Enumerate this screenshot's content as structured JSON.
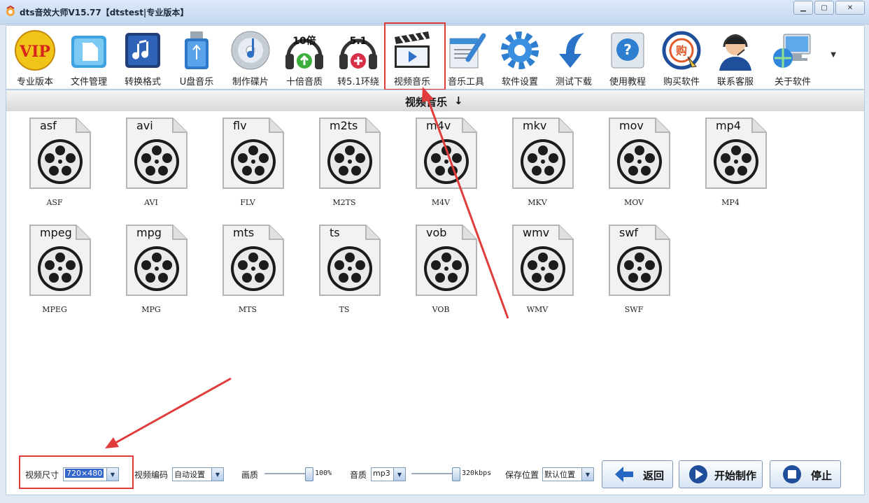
{
  "window": {
    "title": "dts音效大师V15.77【dtstest|专业版本】"
  },
  "toolbar": {
    "items": [
      {
        "label": "专业版本",
        "icon": "vip-icon"
      },
      {
        "label": "文件管理",
        "icon": "file-manager-icon"
      },
      {
        "label": "转换格式",
        "icon": "music-note-icon"
      },
      {
        "label": "U盘音乐",
        "icon": "usb-drive-icon"
      },
      {
        "label": "制作碟片",
        "icon": "cd-disc-icon"
      },
      {
        "label": "十倍音质",
        "icon": "headphones-10x-icon",
        "badge": "10倍"
      },
      {
        "label": "转5.1环绕",
        "icon": "headphones-51-icon",
        "badge": "5.1"
      },
      {
        "label": "视频音乐",
        "icon": "clapperboard-icon"
      },
      {
        "label": "音乐工具",
        "icon": "tools-icon"
      },
      {
        "label": "软件设置",
        "icon": "gear-icon"
      },
      {
        "label": "测试下载",
        "icon": "download-arrow-icon"
      },
      {
        "label": "使用教程",
        "icon": "help-icon"
      },
      {
        "label": "购买软件",
        "icon": "buy-icon",
        "badge": "购"
      },
      {
        "label": "联系客服",
        "icon": "support-agent-icon"
      },
      {
        "label": "关于软件",
        "icon": "computer-globe-icon"
      }
    ],
    "active": "视频音乐"
  },
  "section": {
    "title": "视频音乐",
    "arrow": "↓"
  },
  "formats": [
    {
      "ext": "asf",
      "name": "ASF"
    },
    {
      "ext": "avi",
      "name": "AVI"
    },
    {
      "ext": "flv",
      "name": "FLV"
    },
    {
      "ext": "m2ts",
      "name": "M2TS"
    },
    {
      "ext": "m4v",
      "name": "M4V"
    },
    {
      "ext": "mkv",
      "name": "MKV"
    },
    {
      "ext": "mov",
      "name": "MOV"
    },
    {
      "ext": "mp4",
      "name": "MP4"
    },
    {
      "ext": "mpeg",
      "name": "MPEG"
    },
    {
      "ext": "mpg",
      "name": "MPG"
    },
    {
      "ext": "mts",
      "name": "MTS"
    },
    {
      "ext": "ts",
      "name": "TS"
    },
    {
      "ext": "vob",
      "name": "VOB"
    },
    {
      "ext": "wmv",
      "name": "WMV"
    },
    {
      "ext": "swf",
      "name": "SWF"
    }
  ],
  "settings": {
    "size_label": "视频尺寸",
    "size_value": "720×480",
    "codec_label": "视频编码",
    "codec_value": "自动设置",
    "quality_label": "画质",
    "quality_value": "100%",
    "quality_level": 1.0,
    "audio_label": "音质",
    "audio_format": "mp3",
    "bitrate": "320kbps",
    "audio_level": 1.0,
    "save_label": "保存位置",
    "save_value": "默认位置"
  },
  "buttons": {
    "back": "返回",
    "start": "开始制作",
    "stop": "停止"
  },
  "colors": {
    "highlight_red": "#e03c3c",
    "accent_blue": "#1e5fb8"
  }
}
